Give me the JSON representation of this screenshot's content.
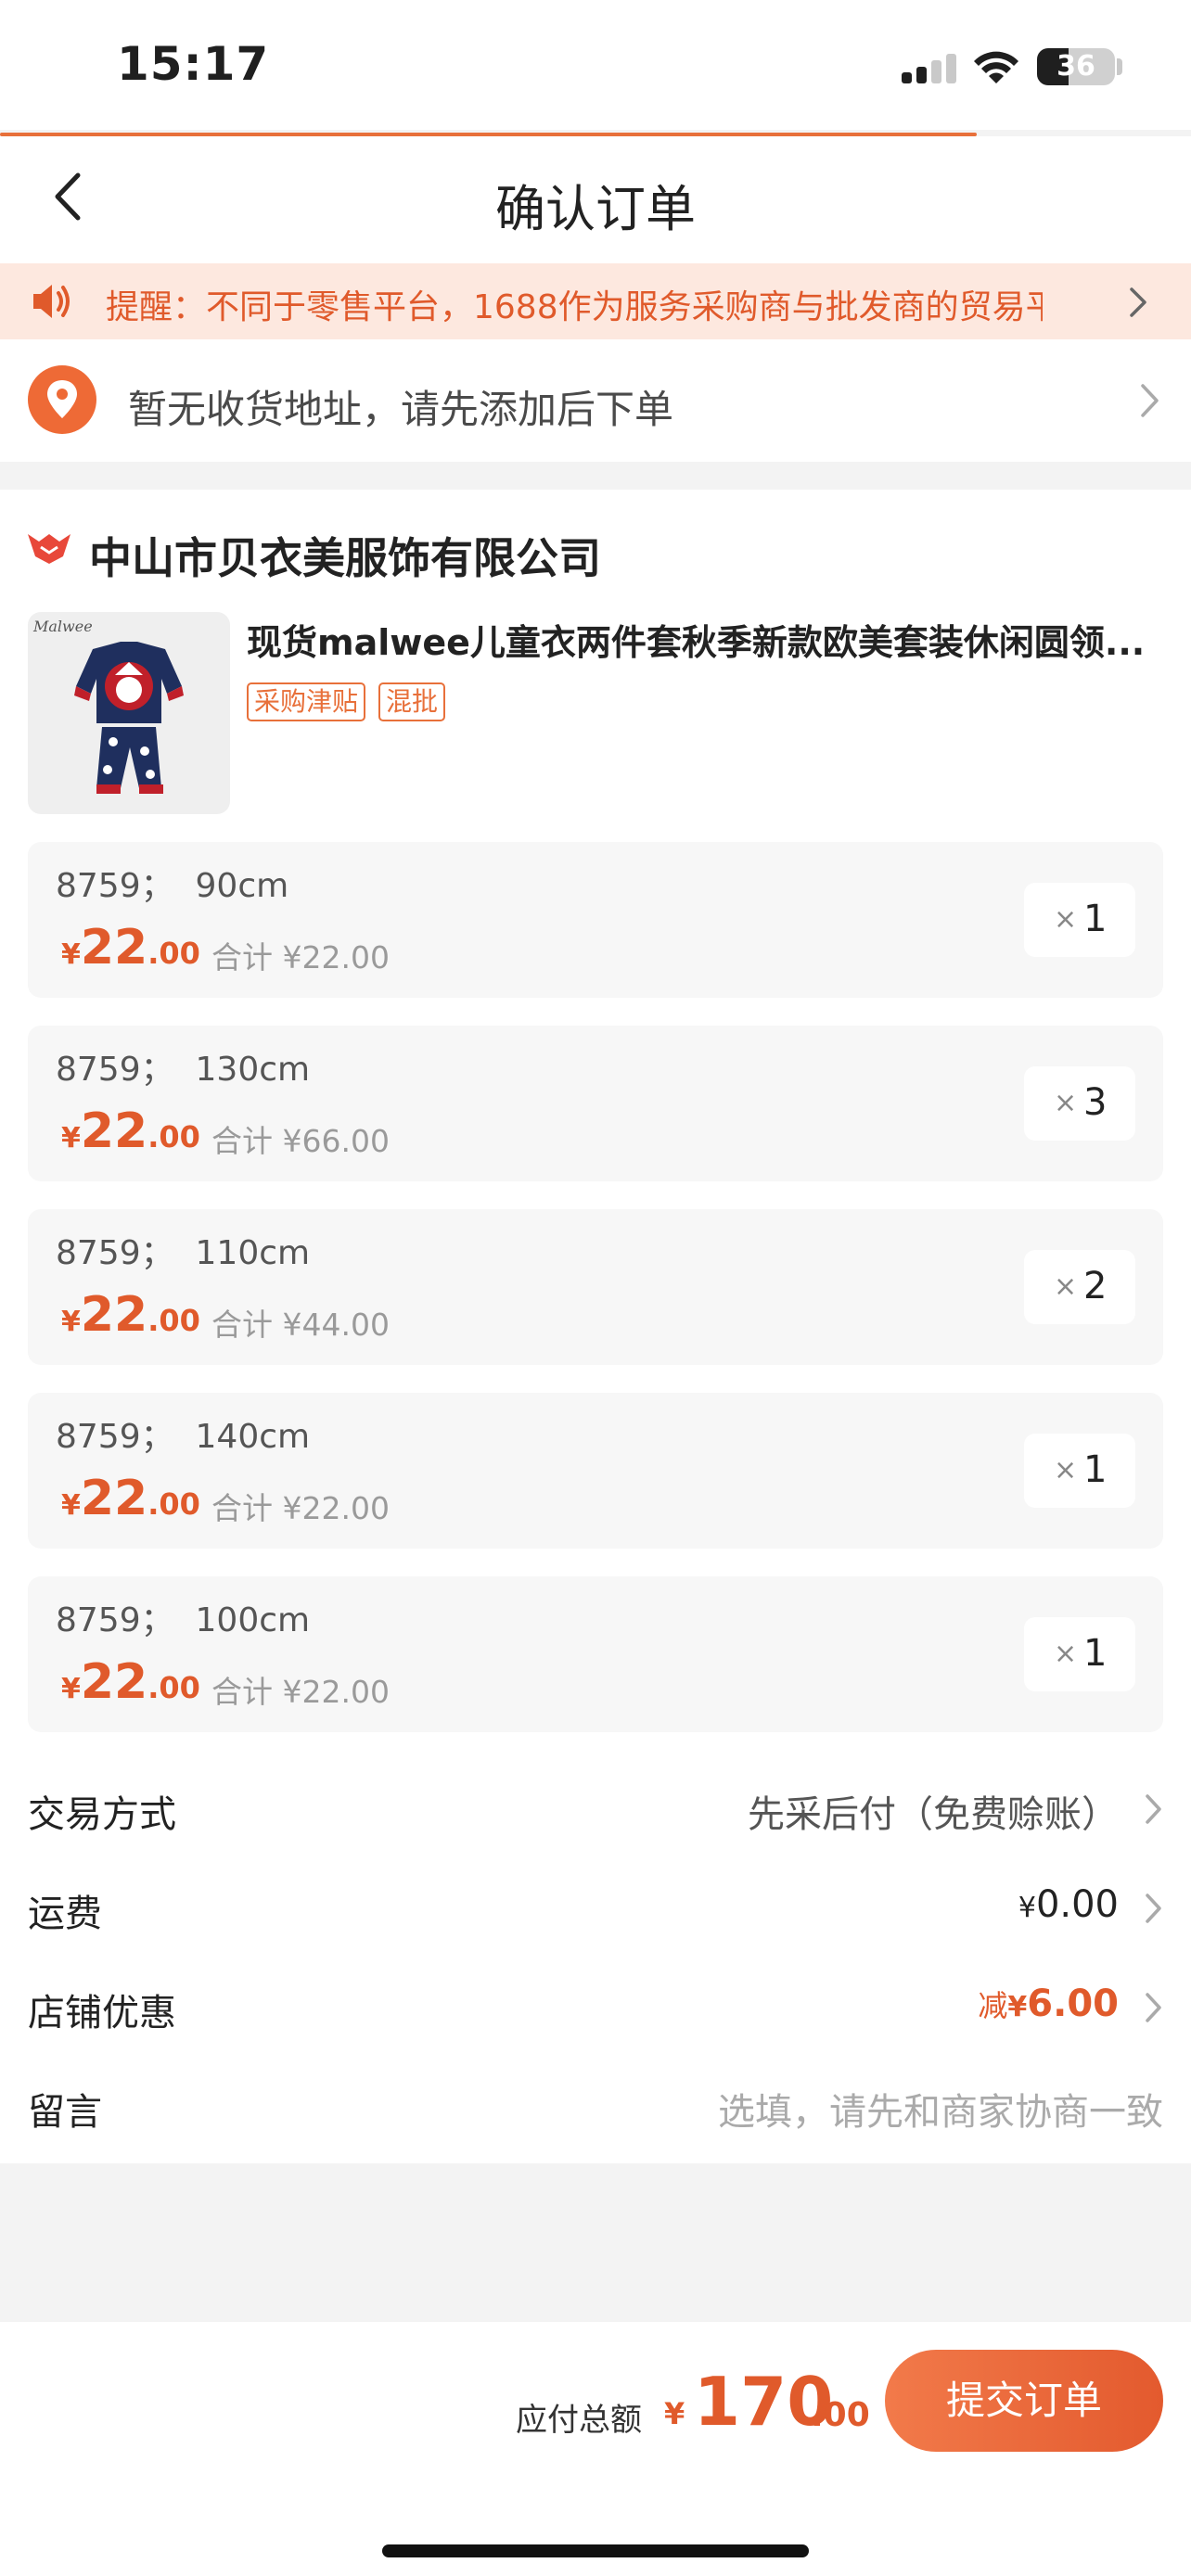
{
  "status_bar": {
    "time": "15:17",
    "battery": "36"
  },
  "nav": {
    "title": "确认订单"
  },
  "notice": {
    "text": "提醒：不同于零售平台，1688作为服务采购商与批发商的贸易平"
  },
  "address": {
    "text": "暂无收货地址，请先添加后下单"
  },
  "shop": {
    "name": "中山市贝衣美服饰有限公司"
  },
  "product": {
    "title": "现货malwee儿童衣两件套秋季新款欧美套装休闲圆领...",
    "thumb_logo": "Malwee",
    "tags": [
      "采购津贴",
      "混批"
    ]
  },
  "skus": [
    {
      "spec": "8759；  90cm",
      "currency": "¥",
      "price_int": "22",
      "price_dec": ".00",
      "subtotal": "合计 ¥22.00",
      "qty_x": "×",
      "qty": "1"
    },
    {
      "spec": "8759；  130cm",
      "currency": "¥",
      "price_int": "22",
      "price_dec": ".00",
      "subtotal": "合计 ¥66.00",
      "qty_x": "×",
      "qty": "3"
    },
    {
      "spec": "8759；  110cm",
      "currency": "¥",
      "price_int": "22",
      "price_dec": ".00",
      "subtotal": "合计 ¥44.00",
      "qty_x": "×",
      "qty": "2"
    },
    {
      "spec": "8759；  140cm",
      "currency": "¥",
      "price_int": "22",
      "price_dec": ".00",
      "subtotal": "合计 ¥22.00",
      "qty_x": "×",
      "qty": "1"
    },
    {
      "spec": "8759；  100cm",
      "currency": "¥",
      "price_int": "22",
      "price_dec": ".00",
      "subtotal": "合计 ¥22.00",
      "qty_x": "×",
      "qty": "1"
    }
  ],
  "summary": {
    "trade_label": "交易方式",
    "trade_value": "先采后付（免费赊账）",
    "shipping_label": "运费",
    "shipping_cur": "¥",
    "shipping_value": "0.00",
    "discount_label": "店铺优惠",
    "discount_prefix": "减",
    "discount_cur": "¥",
    "discount_value": "6.00",
    "message_label": "留言",
    "message_placeholder": "选填，请先和商家协商一致"
  },
  "footer": {
    "total_label": "应付总额",
    "currency": "¥",
    "total_int": "170",
    "total_dec": ".00",
    "submit_label": "提交订单"
  },
  "colors": {
    "accent": "#E8703A",
    "price": "#E05A2B",
    "notice_bg": "#FDE8DF"
  }
}
